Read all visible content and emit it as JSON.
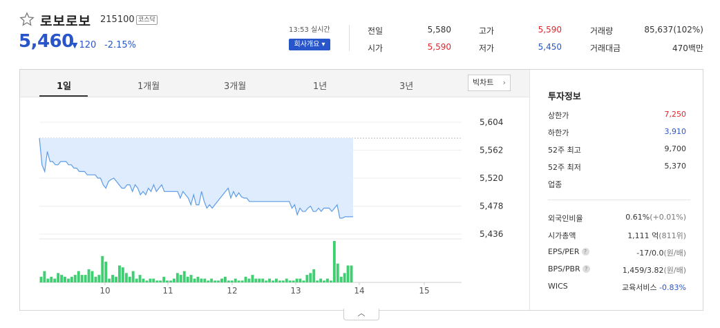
{
  "header": {
    "name": "로보로보",
    "code": "215100",
    "market": "코스닥",
    "price": "5,460",
    "change_arrow": "▼",
    "change": "120",
    "change_rate": "-2.15%",
    "realtime": "13:53 실시간",
    "company_button": "회사개요 ▾"
  },
  "quote": {
    "prev_close_label": "전일",
    "prev_close": "5,580",
    "open_label": "시가",
    "open": "5,590",
    "high_label": "고가",
    "high": "5,590",
    "low_label": "저가",
    "low": "5,450",
    "volume_label": "거래량",
    "volume": "85,637(102%)",
    "amount_label": "거래대금",
    "amount": "470백만"
  },
  "tabs": [
    "1일",
    "1개월",
    "3개월",
    "1년",
    "3년"
  ],
  "big_chart_button": "빅차트",
  "collapse_icon": "chevron-up-icon",
  "colors": {
    "up": "#e0242c",
    "down": "#2855c9",
    "line": "#5b9be8",
    "area": "#deecfd",
    "volume": "#3fcf72"
  },
  "chart_data": {
    "type": "line",
    "price_ticks": [
      "5,604",
      "5,562",
      "5,520",
      "5,478",
      "5,436"
    ],
    "tick_values": [
      5604,
      5562,
      5520,
      5478,
      5436
    ],
    "prev_close_ref": 5580,
    "x_labels": [
      "10",
      "11",
      "12",
      "13",
      "14",
      "15"
    ],
    "price_series": [
      5580,
      5540,
      5530,
      5560,
      5545,
      5545,
      5540,
      5540,
      5545,
      5545,
      5545,
      5540,
      5540,
      5535,
      5535,
      5530,
      5530,
      5530,
      5525,
      5525,
      5525,
      5525,
      5520,
      5520,
      5510,
      5505,
      5515,
      5518,
      5520,
      5515,
      5510,
      5505,
      5505,
      5510,
      5510,
      5500,
      5510,
      5505,
      5495,
      5500,
      5495,
      5505,
      5500,
      5510,
      5500,
      5505,
      5510,
      5500,
      5500,
      5500,
      5500,
      5500,
      5500,
      5490,
      5500,
      5495,
      5490,
      5480,
      5495,
      5480,
      5480,
      5500,
      5485,
      5475,
      5480,
      5475,
      5480,
      5485,
      5490,
      5495,
      5500,
      5505,
      5490,
      5500,
      5492,
      5498,
      5492,
      5490,
      5490,
      5485,
      5485,
      5485,
      5485,
      5485,
      5485,
      5485,
      5485,
      5485,
      5485,
      5485,
      5485,
      5485,
      5485,
      5485,
      5485,
      5475,
      5480,
      5465,
      5475,
      5470,
      5470,
      5475,
      5478,
      5470,
      5470,
      5475,
      5470,
      5475,
      5475,
      5475,
      5470,
      5475,
      5480,
      5460,
      5460,
      5462,
      5462,
      5462,
      5462
    ],
    "volume_series": [
      3,
      6,
      2,
      3,
      2,
      5,
      4,
      3,
      2,
      3,
      4,
      6,
      4,
      4,
      7,
      6,
      3,
      4,
      14,
      11,
      2,
      4,
      3,
      9,
      8,
      5,
      3,
      6,
      2,
      4,
      2,
      1,
      2,
      2,
      1,
      1,
      3,
      1,
      1,
      2,
      5,
      4,
      6,
      3,
      4,
      2,
      3,
      2,
      2,
      1,
      2,
      1,
      1,
      2,
      3,
      1,
      1,
      2,
      1,
      1,
      3,
      2,
      4,
      2,
      2,
      2,
      1,
      2,
      1,
      2,
      1,
      1,
      2,
      1,
      1,
      2,
      2,
      1,
      4,
      5,
      7,
      1,
      2,
      1,
      2,
      1,
      22,
      10,
      3,
      5,
      9,
      9
    ]
  },
  "info": {
    "title": "투자정보",
    "rows": [
      {
        "label": "상한가",
        "value": "7,250",
        "tone": "up"
      },
      {
        "label": "하한가",
        "value": "3,910",
        "tone": "down"
      },
      {
        "label": "52주 최고",
        "value": "9,700",
        "tone": ""
      },
      {
        "label": "52주 최저",
        "value": "5,370",
        "tone": ""
      },
      {
        "label": "업종",
        "value": "",
        "tone": ""
      }
    ],
    "foreign_label": "외국인비율",
    "foreign_value": "0.61%",
    "foreign_sub": "(+0.01%)",
    "mcap_label": "시가총액",
    "mcap_value": "1,111 억",
    "mcap_sub": "(811위)",
    "eps_label": "EPS/PER",
    "eps_value": "-17/0.0",
    "eps_sub": "(원/배)",
    "bps_label": "BPS/PBR",
    "bps_value": "1,459/3.82",
    "bps_sub": "(원/배)",
    "wics_label": "WICS",
    "wics_value": "교육서비스",
    "wics_sub": "-0.83%"
  }
}
